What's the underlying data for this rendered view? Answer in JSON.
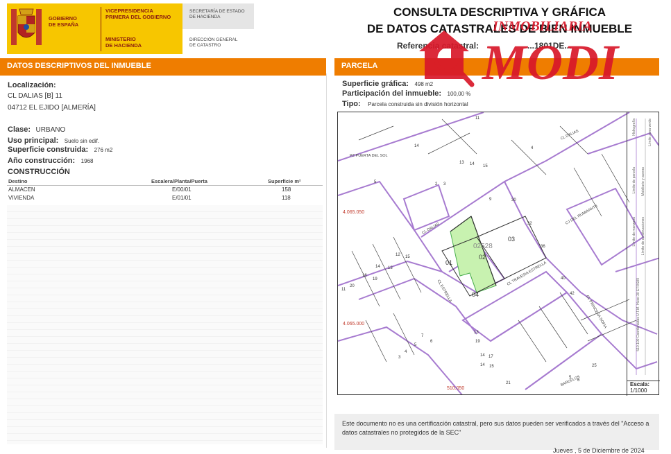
{
  "header": {
    "gov_name": [
      "GOBIERNO",
      "DE ESPAÑA"
    ],
    "vicepresidencia": [
      "VICEPRESIDENCIA",
      "PRIMERA DEL GOBIERNO"
    ],
    "ministerio": [
      "MINISTERIO",
      "DE HACIENDA"
    ],
    "secretaria": [
      "SECRETARÍA DE ESTADO",
      "DE HACIENDA"
    ],
    "direccion": [
      "DIRECCIÓN GENERAL",
      "DE CATASTRO"
    ],
    "title_line1": "CONSULTA DESCRIPTIVA Y GRÁFICA",
    "title_line2": "DE DATOS CATASTRALES DE BIEN INMUEBLE",
    "ref_label": "Referencia catastral:",
    "ref_value": "...1801DE..."
  },
  "left": {
    "section_title": "DATOS DESCRIPTIVOS DEL INMUEBLE",
    "localizacion_label": "Localización:",
    "address_line1": "CL DALIAS [B] 11",
    "address_line2": "04712 EL EJIDO [ALMERÍA]",
    "clase_label": "Clase:",
    "clase_value": "URBANO",
    "uso_label": "Uso principal:",
    "uso_value": "Suelo sin edif.",
    "sup_label": "Superficie construida:",
    "sup_value": "276 m2",
    "anio_label": "Año construcción:",
    "anio_value": "1968",
    "construccion_title": "CONSTRUCCIÓN",
    "table": {
      "headers": [
        "Destino",
        "Escalera/Planta/Puerta",
        "Superficie m²"
      ],
      "rows": [
        [
          "ALMACEN",
          "E/00/01",
          "158"
        ],
        [
          "VIVIENDA",
          "E/01/01",
          "118"
        ]
      ]
    }
  },
  "right": {
    "section_title": "PARCELA",
    "sup_grafica_label": "Superficie gráfica:",
    "sup_grafica_value": "498 m2",
    "participacion_label": "Participación del inmueble:",
    "participacion_value": "100,00 %",
    "tipo_label": "Tipo:",
    "tipo_value": "Parcela construida sin división horizontal",
    "scale_label": "Escala:",
    "scale_value": "1/1000"
  },
  "map": {
    "streets": [
      "CL DALIAS",
      "PZ PUERTA DEL SOL",
      "CL DALIAS",
      "CJ DEL RUMIAANTE",
      "CL ESTRELLA",
      "CL TRAVESIA ESTRELLA",
      "CL PRINCESA SOFIA",
      "BARCELOS"
    ],
    "numbers": [
      "11",
      "14",
      "4",
      "13",
      "14",
      "15",
      "5",
      "2",
      "3",
      "9",
      "30",
      "32",
      "36",
      "40",
      "42",
      "25",
      "12",
      "13",
      "14",
      "15",
      "16",
      "19",
      "20",
      "11",
      "7",
      "4",
      "3",
      "5",
      "6",
      "19",
      "13",
      "14",
      "17",
      "14",
      "15",
      "21",
      "5",
      "6"
    ],
    "block_labels": [
      "02528",
      "01",
      "02",
      "03",
      "04"
    ],
    "coord_labels": [
      "4.065.050",
      "4.065.000",
      "510.050"
    ],
    "legend": [
      "Límite de manzana",
      "Límite de parcela",
      "Límite de construcciones",
      "Mobiliario y aceras",
      "Límite zona verde",
      "Hidrografía"
    ],
    "legend_coords": "510.100 Coordenadas U.T.M. Huso 30 ETRS89"
  },
  "disclaimer": "Este documento no es una certificación catastral, pero sus datos pueden ser verificados a través del \"Acceso a datos catastrales no protegidos de la SEC\"",
  "date": "Jueves , 5 de Diciembre de 2024",
  "watermark": {
    "top": "INMOBILIARIA",
    "main": "MODI"
  },
  "colors": {
    "orange": "#ef7d00",
    "gov_yellow": "#f7c600",
    "parcel_green": "#c8f2b0",
    "street_purple": "#a77bd0",
    "watermark_red": "#d8182a"
  }
}
